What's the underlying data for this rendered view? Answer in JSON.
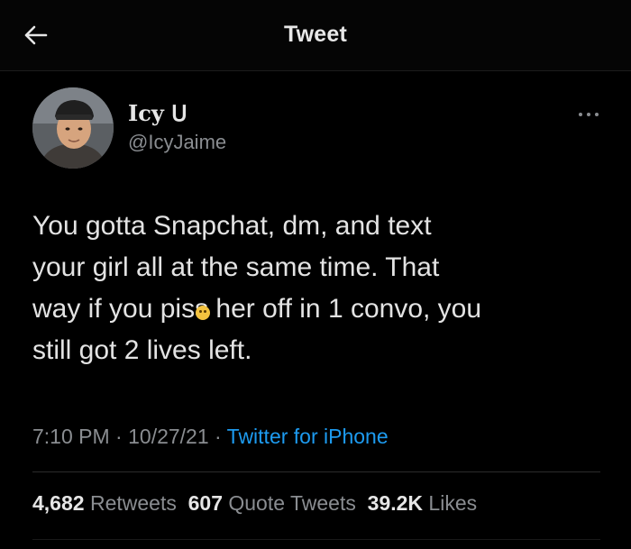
{
  "header": {
    "title": "Tweet",
    "back_icon": "arrow-left-icon"
  },
  "author": {
    "display_name": "Icy ᑌ",
    "username": "@IcyJaime"
  },
  "tweet": {
    "line1": "You gotta Snapchat, dm, and text",
    "line2": "your girl all at the same time. That",
    "line3_before": "way if you piss",
    "emoji": "face-emoji",
    "line3_after": " her off in 1 convo, you",
    "line4": "still got 2 lives left."
  },
  "meta": {
    "time": "7:10 PM",
    "separator1": " · ",
    "date": "10/27/21",
    "separator2": " · ",
    "source": "Twitter for iPhone"
  },
  "stats": {
    "retweets_count": "4,682",
    "retweets_label": "Retweets",
    "quotes_count": "607",
    "quotes_label": "Quote Tweets",
    "likes_count": "39.2K",
    "likes_label": "Likes"
  },
  "colors": {
    "background": "#000000",
    "text_primary": "#e3e3e3",
    "text_secondary": "#8a8d91",
    "link": "#1d9bf0"
  }
}
